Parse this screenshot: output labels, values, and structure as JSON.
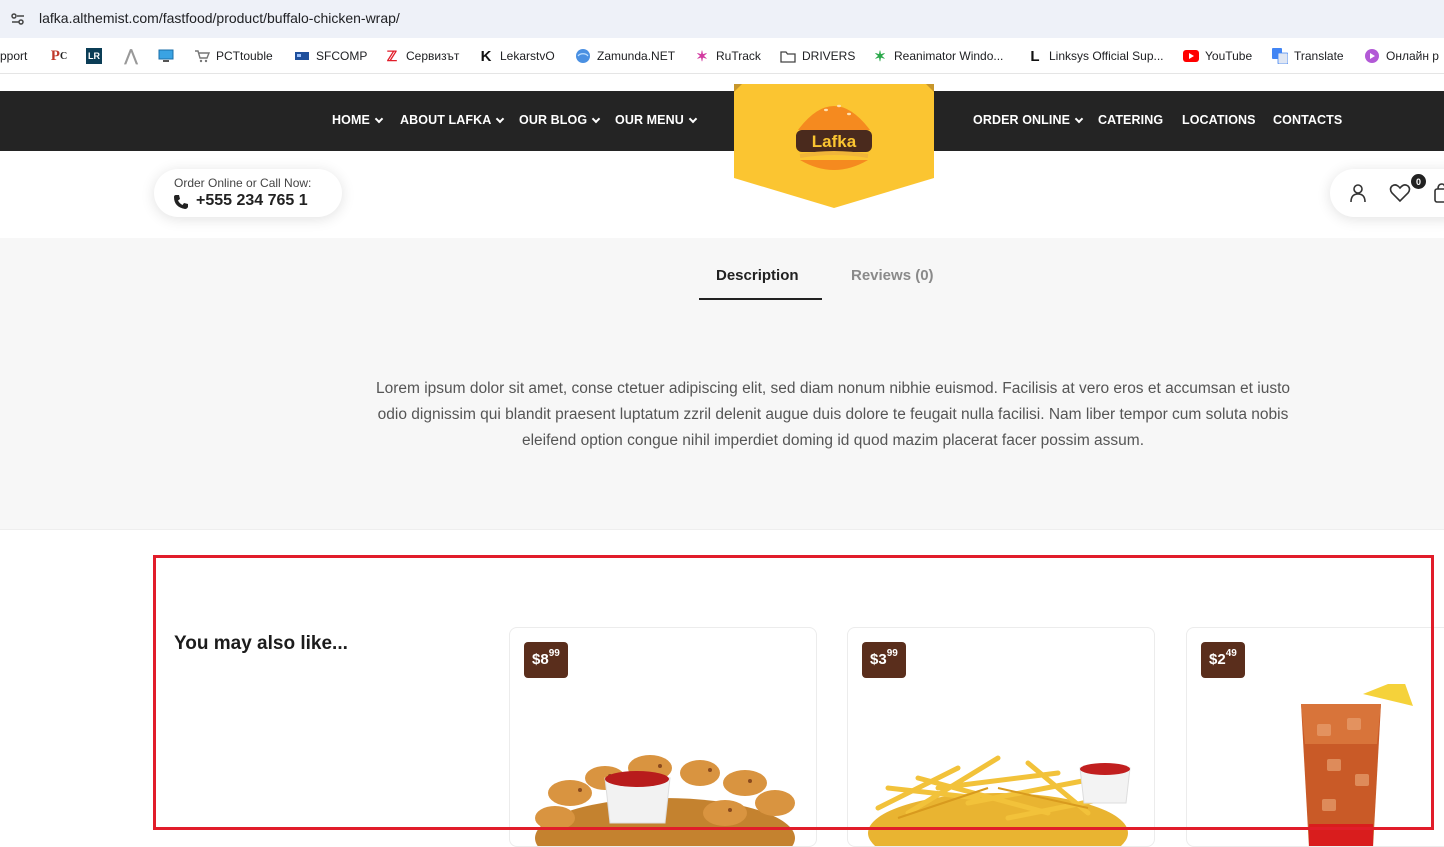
{
  "browser": {
    "url": "lafka.althemist.com/fastfood/product/buffalo-chicken-wrap/",
    "bookmarks": [
      {
        "label": "pport",
        "icon": "none"
      },
      {
        "label": "",
        "icon": "pc-logo-icon"
      },
      {
        "label": "",
        "icon": "lr-logo-icon"
      },
      {
        "label": "",
        "icon": "caret-icon"
      },
      {
        "label": "",
        "icon": "monitor-icon"
      },
      {
        "label": "PCTtouble",
        "icon": "cart-icon"
      },
      {
        "label": "SFCOMP",
        "icon": "sfcomp-icon"
      },
      {
        "label": "Сервизът",
        "icon": "service-icon"
      },
      {
        "label": "LekarstvO",
        "icon": "k-logo-icon"
      },
      {
        "label": "Zamunda.NET",
        "icon": "globe-icon"
      },
      {
        "label": "RuTrack",
        "icon": "star-icon"
      },
      {
        "label": "DRIVERS",
        "icon": "folder-icon"
      },
      {
        "label": "Reanimator Windo...",
        "icon": "star-icon"
      },
      {
        "label": "Linksys Official Sup...",
        "icon": "linksys-icon"
      },
      {
        "label": "YouTube",
        "icon": "youtube-icon"
      },
      {
        "label": "Translate",
        "icon": "translate-icon"
      },
      {
        "label": "Онлайн р",
        "icon": "play-icon"
      }
    ]
  },
  "header": {
    "nav_left": [
      {
        "label": "HOME",
        "dropdown": true
      },
      {
        "label": "ABOUT LAFKA",
        "dropdown": true
      },
      {
        "label": "OUR BLOG",
        "dropdown": true
      },
      {
        "label": "OUR MENU",
        "dropdown": true
      }
    ],
    "nav_right": [
      {
        "label": "ORDER ONLINE",
        "dropdown": true
      },
      {
        "label": "CATERING",
        "dropdown": false
      },
      {
        "label": "LOCATIONS",
        "dropdown": false
      },
      {
        "label": "CONTACTS",
        "dropdown": false
      }
    ],
    "logo_text": "Lafka",
    "call_label": "Order Online or Call Now:",
    "call_phone": "+555 234 765 1",
    "wishlist_count": "0"
  },
  "tabs": {
    "items": [
      "Description",
      "Reviews (0)"
    ],
    "active": "Description",
    "description": "Lorem ipsum dolor sit amet, conse ctetuer adipiscing elit, sed diam nonum nibhie euismod. Facilisis at vero eros et accumsan et iusto odio dignissim qui blandit praesent luptatum zzril delenit augue duis dolore te feugait nulla facilisi. Nam liber tempor cum soluta nobis eleifend option congue nihil imperdiet doming id quod mazim placerat facer possim assum."
  },
  "related": {
    "title": "You may also like...",
    "products": [
      {
        "price_main": "$8",
        "price_cents": "99",
        "image": "chicken-nuggets"
      },
      {
        "price_main": "$3",
        "price_cents": "99",
        "image": "french-fries"
      },
      {
        "price_main": "$2",
        "price_cents": "49",
        "image": "iced-tea"
      }
    ]
  },
  "colors": {
    "nav_bg": "#242424",
    "logo_yellow": "#fbc531",
    "price_badge": "#5a2e1c",
    "highlight_frame": "#e11d2a"
  }
}
